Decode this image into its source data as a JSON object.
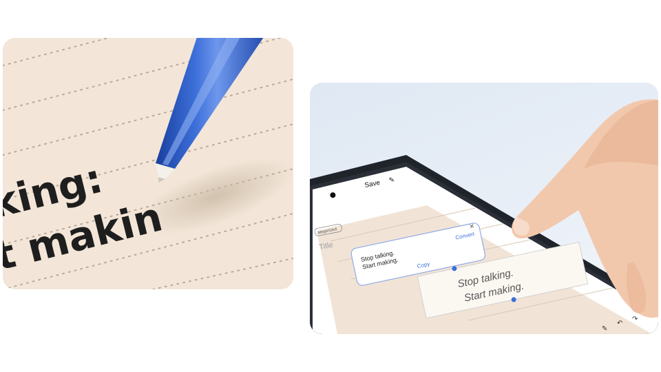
{
  "left_panel": {
    "handwriting_line1": "king:",
    "handwriting_line2": "t makin",
    "ink_color": "#1e1e1e",
    "pen_color": "#2f5fc4",
    "paper_color": "#f3e6d8"
  },
  "right_panel": {
    "header": {
      "save_label": "Save"
    },
    "tag_label": "ategorized",
    "title_placeholder": "Title",
    "popup": {
      "text_line1": "Stop talking.",
      "text_line2": "Start making.",
      "copy_label": "Copy",
      "convert_label": "Convert"
    },
    "note_handwriting_line1": "Stop talking.",
    "note_handwriting_line2": "Start making.",
    "accent_color": "#3b6fd8"
  }
}
